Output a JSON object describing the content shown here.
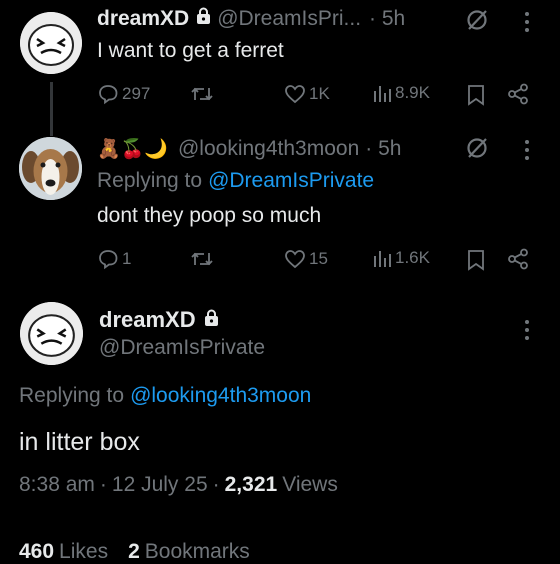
{
  "tweet1": {
    "name": "dreamXD",
    "handle": "@DreamIsPri...",
    "time": "· 5h",
    "text": "I want to get a ferret",
    "replies": "297",
    "likes": "1K",
    "views": "8.9K"
  },
  "tweet2": {
    "emojis": "🧸🍒🌙",
    "handle": "@looking4th3moon",
    "time": "· 5h",
    "replying_prefix": "Replying to",
    "replying_handle": "@DreamIsPrivate",
    "text": "dont they poop so much",
    "replies": "1",
    "likes": "15",
    "views": "1.6K"
  },
  "main_tweet": {
    "name": "dreamXD",
    "handle": "@DreamIsPrivate",
    "replying_prefix": "Replying to",
    "replying_handle": "@looking4th3moon",
    "text": "in litter box",
    "time": "8:38 am",
    "date": "12 July 25",
    "sep": "·",
    "views_count": "2,321",
    "views_label": "Views",
    "likes_count": "460",
    "likes_label": "Likes",
    "bookmarks_count": "2",
    "bookmarks_label": "Bookmarks"
  },
  "icons": {
    "lock": "lock-icon",
    "no_ai": "circle-slash-icon",
    "more": "more-vertical-icon",
    "reply": "reply-icon",
    "repost": "repost-icon",
    "like": "heart-icon",
    "views": "views-bars-icon",
    "bookmark": "bookmark-icon",
    "share": "share-icon"
  },
  "colors": {
    "background": "#000000",
    "text": "#e7e9ea",
    "secondary": "#71767b",
    "accent": "#1d9bf0"
  }
}
